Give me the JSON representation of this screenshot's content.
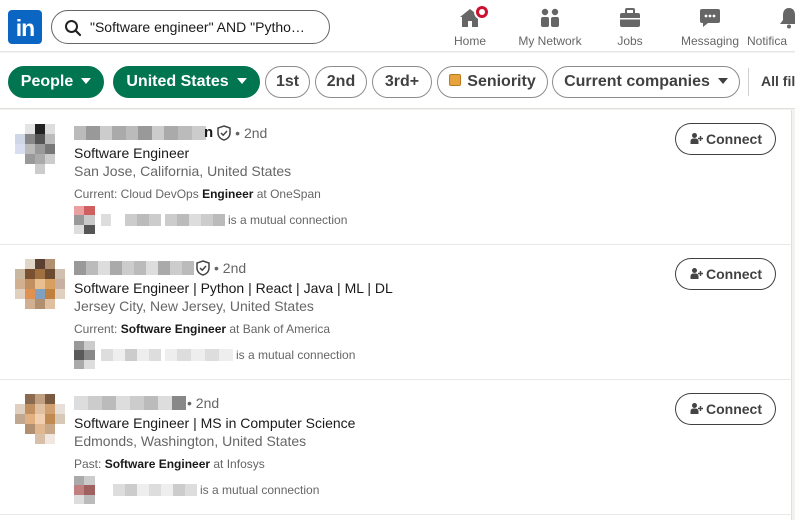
{
  "nav": {
    "logo": "in",
    "search_value": "\"Software engineer\" AND \"Pytho…",
    "items": [
      {
        "label": "Home",
        "icon": "home-icon"
      },
      {
        "label": "My Network",
        "icon": "network-icon"
      },
      {
        "label": "Jobs",
        "icon": "briefcase-icon"
      },
      {
        "label": "Messaging",
        "icon": "messaging-icon"
      },
      {
        "label": "Notifica",
        "icon": "bell-icon"
      }
    ]
  },
  "filters": {
    "people": "People",
    "location": "United States",
    "first": "1st",
    "second": "2nd",
    "third": "3rd+",
    "seniority": "Seniority",
    "companies": "Current companies",
    "all_filters": "All fil"
  },
  "results": [
    {
      "name_tail": "n",
      "degree": "• 2nd",
      "headline": "Software Engineer",
      "location": "San Jose, California, United States",
      "current_prefix": "Current: Cloud DevOps ",
      "current_bold": "Engineer",
      "current_suffix": " at OneSpan",
      "mutual_text": "is a mutual connection",
      "connect_label": "Connect"
    },
    {
      "name_tail": "",
      "degree": "• 2nd",
      "headline": "Software Engineer | Python | React | Java | ML | DL",
      "location": "Jersey City, New Jersey, United States",
      "current_prefix": "Current: ",
      "current_bold": "Software Engineer",
      "current_suffix": " at Bank of America",
      "mutual_text": "is a mutual connection",
      "connect_label": "Connect"
    },
    {
      "name_tail": "",
      "degree": "• 2nd",
      "headline": "Software Engineer | MS in Computer Science",
      "location": "Edmonds, Washington, United States",
      "current_prefix": "Past: ",
      "current_bold": "Software Engineer",
      "current_suffix": " at Infosys",
      "mutual_text": "is a mutual connection",
      "connect_label": "Connect"
    }
  ],
  "colors": {
    "brand_blue": "#0a66c2",
    "active_filter_green": "#01754f",
    "notification_red": "#cb112d"
  }
}
